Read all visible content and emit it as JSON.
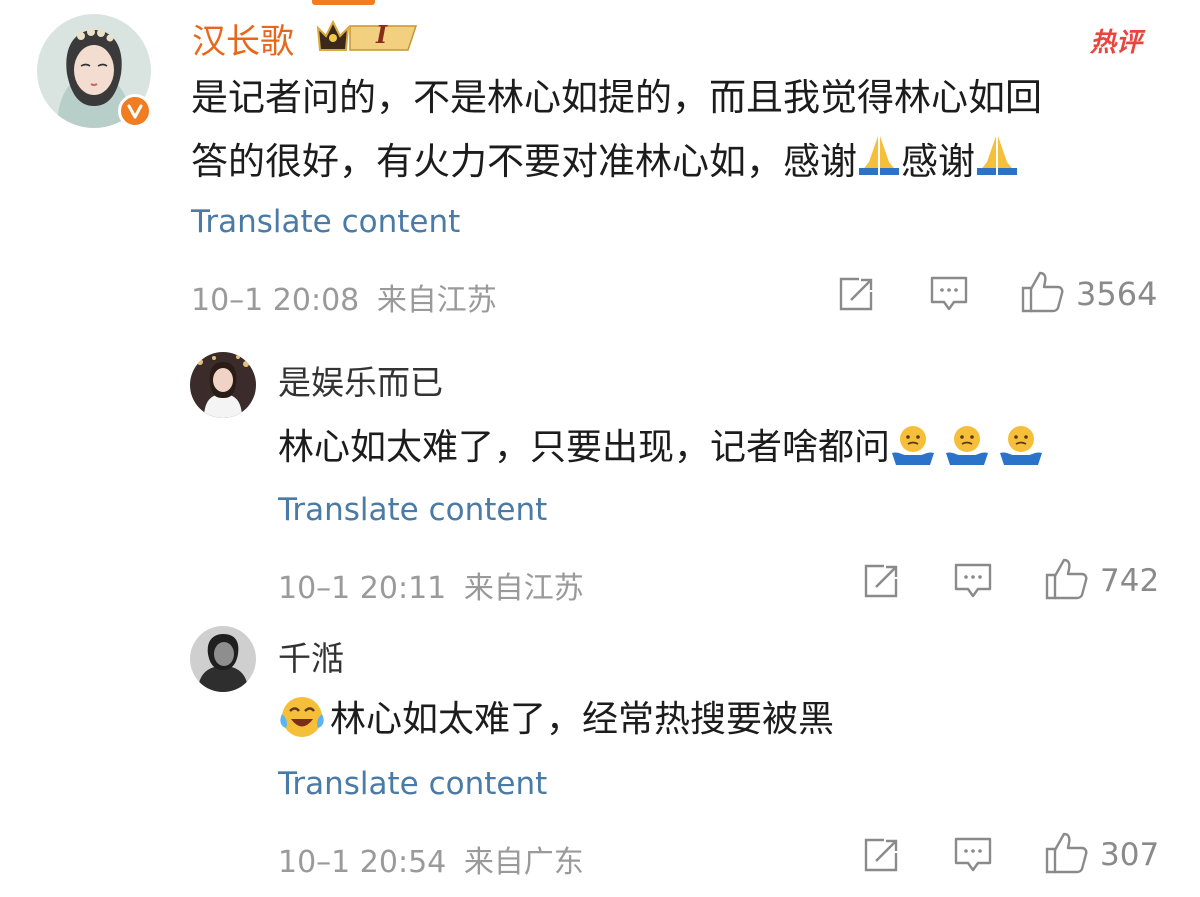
{
  "comments": [
    {
      "username": "汉长歌",
      "badge_level": "I",
      "hot_label": "热评",
      "text_line1": "是记者问的，不是林心如提的，而且我觉得林心如回",
      "text_line2_a": "答的很好，有火力不要对准林心如，感谢",
      "text_line2_b": "感谢",
      "translate": "Translate content",
      "time": "10–1 20:08",
      "location": "来自江苏",
      "likes": "3564",
      "icons": [
        "share-icon",
        "comment-icon",
        "like-icon"
      ]
    },
    {
      "username": "是娱乐而已",
      "text": "林心如太难了，只要出现，记者啥都问",
      "translate": "Translate content",
      "time": "10–1 20:11",
      "location": "来自江苏",
      "likes": "742"
    },
    {
      "username": "千湉",
      "text": "林心如太难了，经常热搜要被黑",
      "translate": "Translate content",
      "time": "10–1 20:54",
      "location": "来自广东",
      "likes": "307"
    }
  ],
  "colors": {
    "username_accent": "#e8671b",
    "link": "#4a7aa6",
    "meta": "#9a9a9a",
    "hot": "#e8463c",
    "verified": "#f07d22"
  }
}
